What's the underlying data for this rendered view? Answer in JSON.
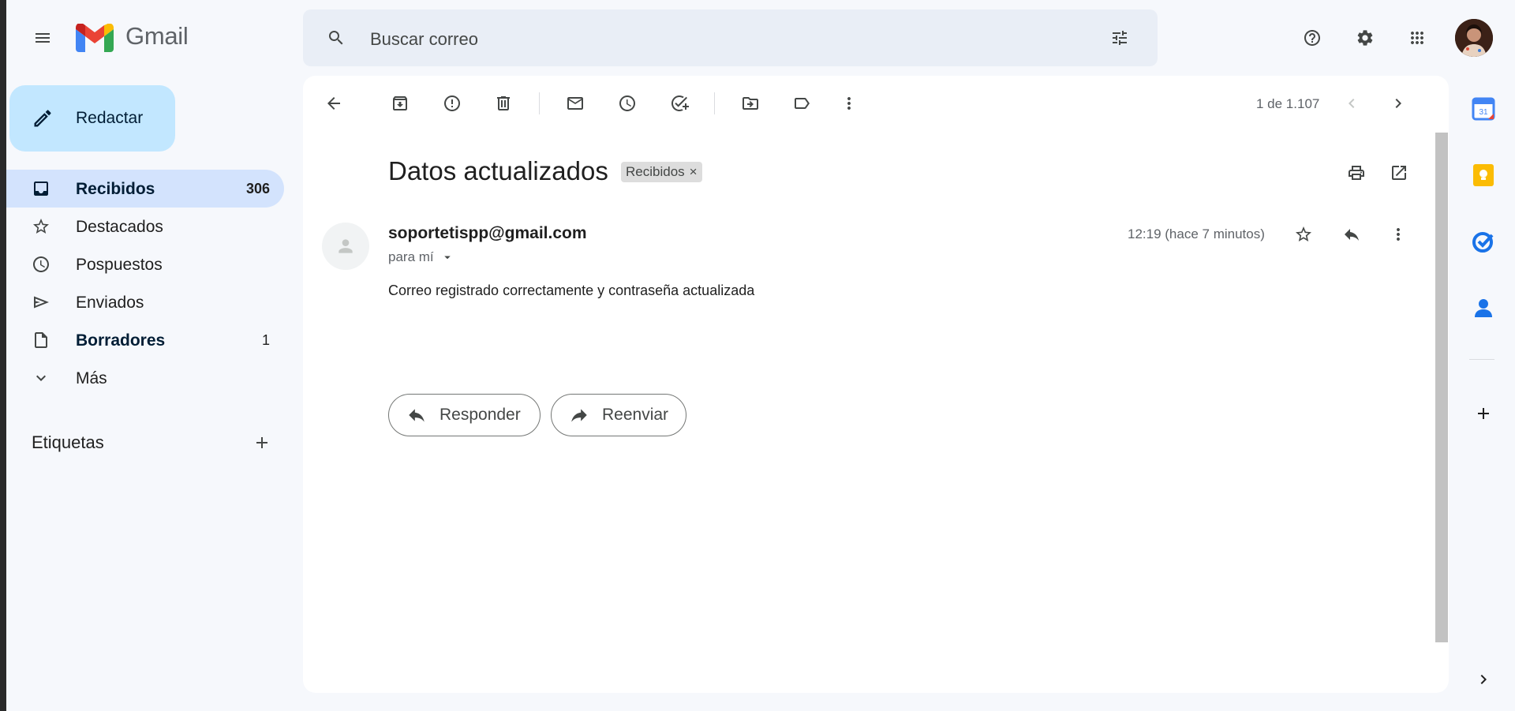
{
  "app": {
    "name": "Gmail"
  },
  "search": {
    "placeholder": "Buscar correo"
  },
  "compose": {
    "label": "Redactar"
  },
  "nav": [
    {
      "label": "Recibidos",
      "count": "306",
      "icon": "inbox-icon",
      "active": true
    },
    {
      "label": "Destacados",
      "count": "",
      "icon": "star-icon"
    },
    {
      "label": "Pospuestos",
      "count": "",
      "icon": "clock-icon"
    },
    {
      "label": "Enviados",
      "count": "",
      "icon": "send-icon"
    },
    {
      "label": "Borradores",
      "count": "1",
      "icon": "draft-icon"
    },
    {
      "label": "Más",
      "count": "",
      "icon": "chevron-down-icon"
    }
  ],
  "labels": {
    "title": "Etiquetas"
  },
  "toolbar": {
    "pager": "1 de 1.107"
  },
  "message": {
    "subject": "Datos actualizados",
    "tag": "Recibidos",
    "tag_remove": "×",
    "sender": "soportetispp@gmail.com",
    "to": "para mí",
    "time": "12:19 (hace 7 minutos)",
    "body": "Correo registrado correctamente y contraseña actualizada"
  },
  "actions": {
    "reply": "Responder",
    "forward": "Reenviar"
  },
  "colors": {
    "background": "#f6f8fc",
    "search_bg": "#e9eef6",
    "compose_bg": "#c2e7ff",
    "active_nav": "#d3e3fd",
    "gmail_red": "#ea4335",
    "gmail_blue": "#4285f4",
    "gmail_green": "#34a853",
    "gmail_yellow": "#fbbc04"
  }
}
